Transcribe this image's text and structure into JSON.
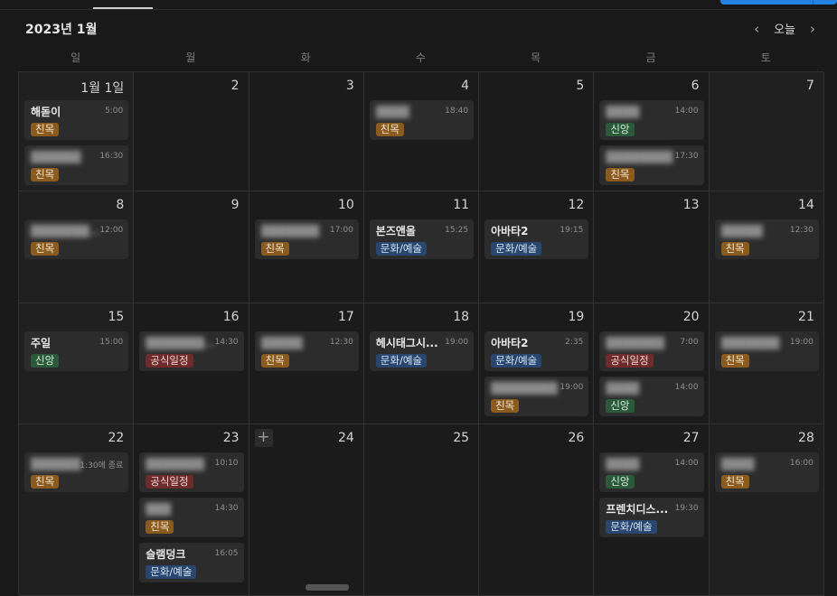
{
  "header": {
    "month_title": "2023년 1월",
    "today_label": "오늘",
    "prev_icon": "chevron-left-icon",
    "next_icon": "chevron-right-icon"
  },
  "weekdays": [
    "일",
    "월",
    "화",
    "수",
    "목",
    "금",
    "토"
  ],
  "colors": {
    "친목": "#8a5a1f",
    "신앙": "#2b5a3b",
    "문화/예술": "#28466e",
    "공식일정": "#6e2b2b"
  },
  "weeks": [
    [
      {
        "date": "1월 1일",
        "events": [
          {
            "title": "해돋이",
            "time": "5:00",
            "tag": "친목",
            "color": "brown",
            "blurred": false
          },
          {
            "title": "██████",
            "time": "16:30",
            "tag": "친목",
            "color": "brown",
            "blurred": true
          }
        ]
      },
      {
        "date": "2",
        "events": []
      },
      {
        "date": "3",
        "events": []
      },
      {
        "date": "4",
        "events": [
          {
            "title": "████",
            "time": "18:40",
            "tag": "친목",
            "color": "brown",
            "blurred": true
          }
        ]
      },
      {
        "date": "5",
        "events": []
      },
      {
        "date": "6",
        "events": [
          {
            "title": "████",
            "time": "14:00",
            "tag": "신앙",
            "color": "green",
            "blurred": true
          },
          {
            "title": "████████",
            "time": "17:30",
            "tag": "친목",
            "color": "brown",
            "blurred": true
          }
        ]
      },
      {
        "date": "7",
        "events": []
      }
    ],
    [
      {
        "date": "8",
        "events": [
          {
            "title": "█████████",
            "time": "12:00",
            "tag": "친목",
            "color": "brown",
            "blurred": true
          }
        ]
      },
      {
        "date": "9",
        "events": []
      },
      {
        "date": "10",
        "events": [
          {
            "title": "███████",
            "time": "17:00",
            "tag": "친목",
            "color": "brown",
            "blurred": true
          }
        ]
      },
      {
        "date": "11",
        "events": [
          {
            "title": "본즈앤올",
            "time": "15:25",
            "tag": "문화/예술",
            "color": "blue",
            "blurred": false
          }
        ]
      },
      {
        "date": "12",
        "events": [
          {
            "title": "아바타2",
            "time": "19:15",
            "tag": "문화/예술",
            "color": "blue",
            "blurred": false
          }
        ]
      },
      {
        "date": "13",
        "events": []
      },
      {
        "date": "14",
        "events": [
          {
            "title": "█████",
            "time": "12:30",
            "tag": "친목",
            "color": "brown",
            "blurred": true
          }
        ]
      }
    ],
    [
      {
        "date": "15",
        "events": [
          {
            "title": "주일",
            "time": "15:00",
            "tag": "신앙",
            "color": "green",
            "blurred": false
          }
        ]
      },
      {
        "date": "16",
        "events": [
          {
            "title": "█████████",
            "time": "14:30",
            "tag": "공식일정",
            "color": "red",
            "blurred": true
          }
        ]
      },
      {
        "date": "17",
        "events": [
          {
            "title": "█████",
            "time": "12:30",
            "tag": "친목",
            "color": "brown",
            "blurred": true
          }
        ]
      },
      {
        "date": "18",
        "events": [
          {
            "title": "헤시태그시...",
            "time": "19:00",
            "tag": "문화/예술",
            "color": "blue",
            "blurred": false
          }
        ]
      },
      {
        "date": "19",
        "events": [
          {
            "title": "아바타2",
            "time": "2:35",
            "tag": "문화/예술",
            "color": "blue",
            "blurred": false
          },
          {
            "title": "████████",
            "time": "19:00",
            "tag": "친목",
            "color": "brown",
            "blurred": true
          }
        ]
      },
      {
        "date": "20",
        "events": [
          {
            "title": "███████",
            "time": "7:00",
            "tag": "공식일정",
            "color": "red",
            "blurred": true
          },
          {
            "title": "████",
            "time": "14:00",
            "tag": "신앙",
            "color": "green",
            "blurred": true
          }
        ]
      },
      {
        "date": "21",
        "events": [
          {
            "title": "███████",
            "time": "19:00",
            "tag": "친목",
            "color": "brown",
            "blurred": true
          }
        ]
      }
    ],
    [
      {
        "date": "22",
        "events": [
          {
            "title": "██████",
            "time": "1:30에 종료",
            "tag": "친목",
            "color": "brown",
            "blurred": true
          }
        ]
      },
      {
        "date": "23",
        "events": [
          {
            "title": "███████",
            "time": "10:10",
            "tag": "공식일정",
            "color": "red",
            "blurred": true
          },
          {
            "title": "███",
            "time": "14:30",
            "tag": "친목",
            "color": "brown",
            "blurred": true
          },
          {
            "title": "슬램덩크",
            "time": "16:05",
            "tag": "문화/예술",
            "color": "blue",
            "blurred": false
          }
        ]
      },
      {
        "date": "24",
        "events": [],
        "add_button": "+"
      },
      {
        "date": "25",
        "events": []
      },
      {
        "date": "26",
        "events": []
      },
      {
        "date": "27",
        "events": [
          {
            "title": "████",
            "time": "14:00",
            "tag": "신앙",
            "color": "green",
            "blurred": true
          },
          {
            "title": "프렌치디스...",
            "time": "19:30",
            "tag": "문화/예술",
            "color": "blue",
            "blurred": false
          }
        ]
      },
      {
        "date": "28",
        "events": [
          {
            "title": "████",
            "time": "16:00",
            "tag": "친목",
            "color": "brown",
            "blurred": true
          }
        ]
      }
    ]
  ]
}
